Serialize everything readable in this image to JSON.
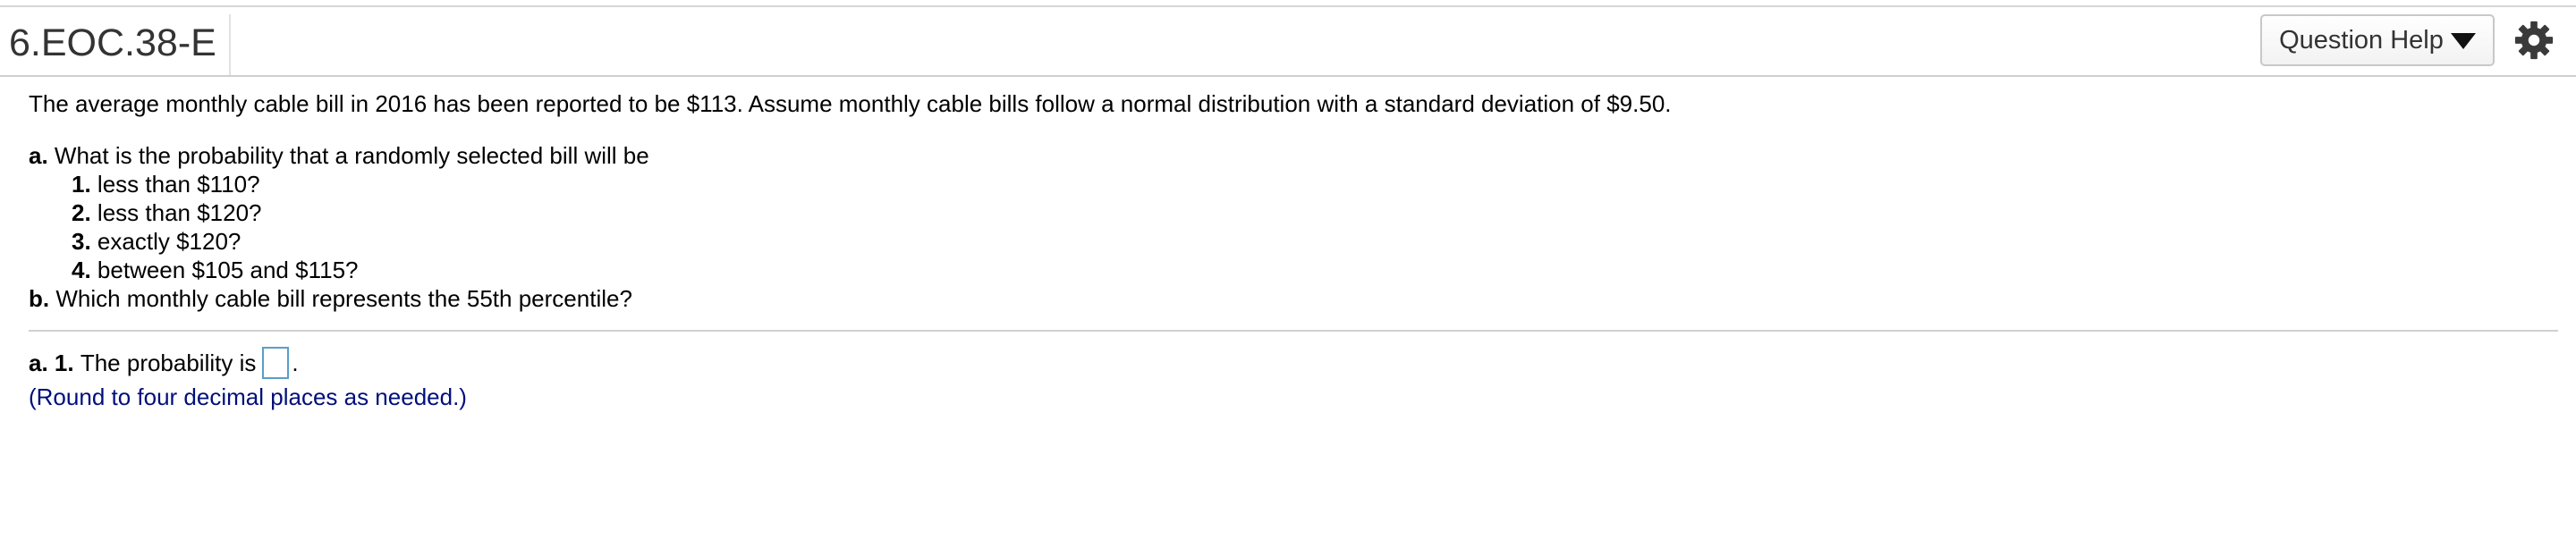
{
  "header": {
    "question_id": "6.EOC.38-E",
    "help_button_label": "Question Help"
  },
  "question": {
    "intro": "The average monthly cable bill in 2016 has been reported to be $113. Assume monthly cable bills follow a normal distribution with a standard deviation of $9.50.",
    "part_a": {
      "marker": "a.",
      "text": "What is the probability that a randomly selected bill will be",
      "items": [
        {
          "marker": "1.",
          "text": "less than $110?"
        },
        {
          "marker": "2.",
          "text": "less than $120?"
        },
        {
          "marker": "3.",
          "text": "exactly $120?"
        },
        {
          "marker": "4.",
          "text": "between $105 and $115?"
        }
      ]
    },
    "part_b": {
      "marker": "b.",
      "text": "Which monthly cable bill represents the 55th percentile?"
    }
  },
  "answer": {
    "marker": "a. 1.",
    "prompt": "The probability is",
    "value": "",
    "suffix": ".",
    "hint": "(Round to four decimal places as needed.)"
  },
  "icons": {
    "help_caret": "caret-down-icon",
    "settings": "gear-icon"
  },
  "colors": {
    "hint_text": "#000f7a",
    "answer_box_border": "#5a9ec9"
  }
}
